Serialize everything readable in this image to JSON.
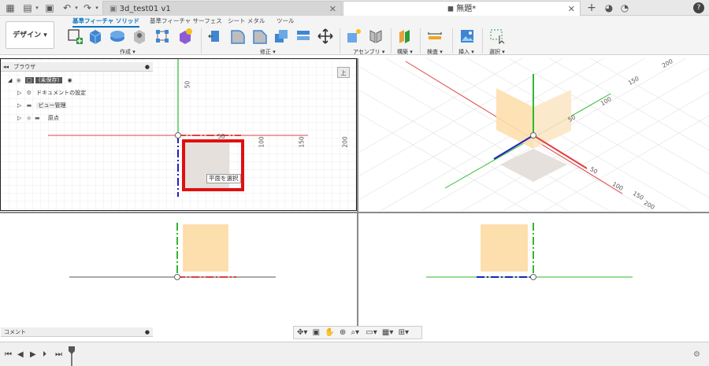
{
  "tabs": [
    {
      "label": "3d_test01 v1"
    },
    {
      "label": "無題*"
    }
  ],
  "workspace": {
    "label": "デザイン ▾"
  },
  "ribbon_tabs": [
    {
      "label": "基準フィーチャ ソリッド"
    },
    {
      "label": "基準フィーチャ サーフェス"
    },
    {
      "label": "シート メタル"
    },
    {
      "label": "ツール"
    }
  ],
  "ribbon_groups": [
    {
      "label": "作成 ▾"
    },
    {
      "label": "修正 ▾"
    },
    {
      "label": "アセンブリ ▾"
    },
    {
      "label": "構築 ▾"
    },
    {
      "label": "検査 ▾"
    },
    {
      "label": "挿入 ▾"
    },
    {
      "label": "選択 ▾"
    }
  ],
  "browser": {
    "title": "ブラウザ",
    "root": "(未保存)",
    "items": [
      {
        "label": "ドキュメントの設定"
      },
      {
        "label": "ビュー管理"
      },
      {
        "label": "原点"
      }
    ]
  },
  "viewport_top_left": {
    "view_cube": "上",
    "tooltip": "平面を選択",
    "axis_labels": [
      "50",
      "50",
      "100",
      "150",
      "200"
    ]
  },
  "viewport_top_right": {
    "axis_labels": [
      "200",
      "150",
      "100",
      "50",
      "50",
      "100",
      "150",
      "200"
    ]
  },
  "comments": {
    "label": "コメント"
  },
  "colors": {
    "accent": "#0a75c2",
    "highlight_red": "#e01010",
    "plane_orange": "#fddfad",
    "axis_x": "#e04040",
    "axis_y": "#2fb82f",
    "axis_z": "#2020c0"
  }
}
